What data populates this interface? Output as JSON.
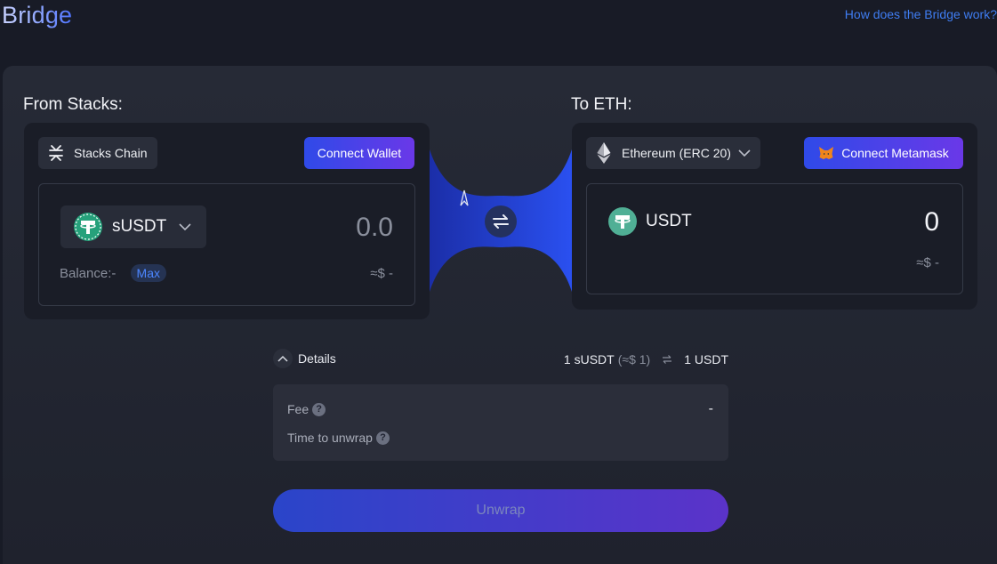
{
  "header": {
    "title": "Bridge",
    "help_link": "How does the Bridge work?"
  },
  "from": {
    "label": "From Stacks:",
    "chain": "Stacks Chain",
    "connect_button": "Connect Wallet",
    "token": "sUSDT",
    "amount": "0.0",
    "balance": "Balance:-",
    "max": "Max",
    "usd_value": "≈$ -"
  },
  "to": {
    "label": "To ETH:",
    "chain": "Ethereum (ERC 20)",
    "connect_button": "Connect Metamask",
    "token": "USDT",
    "amount": "0",
    "usd_value": "≈$ -"
  },
  "details": {
    "toggle_label": "Details",
    "rate_left": "1 sUSDT",
    "rate_usd": "(≈$ 1)",
    "rate_right": "1 USDT",
    "fee_label": "Fee",
    "fee_value": "-",
    "time_label": "Time to unwrap",
    "help_mark": "?"
  },
  "action": {
    "unwrap_label": "Unwrap"
  },
  "colors": {
    "accent": "#3f7df2",
    "tether_green": "#26a17b",
    "gradient_start": "#2f4ae8",
    "gradient_end": "#6a38e8"
  },
  "icons": [
    "stacks-icon",
    "ethereum-icon",
    "metamask-icon",
    "tether-icon",
    "chevron-down-icon",
    "chevron-up-icon",
    "swap-arrows-icon",
    "help-icon"
  ]
}
